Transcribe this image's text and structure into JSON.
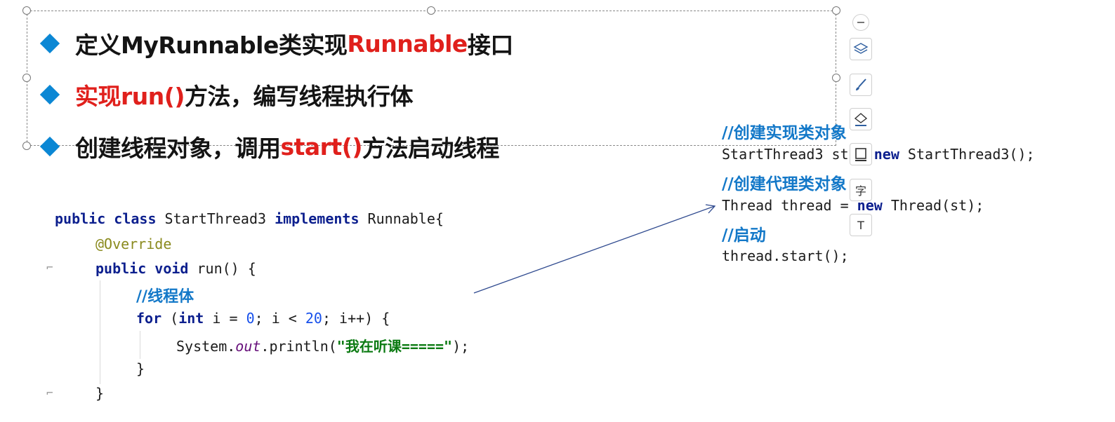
{
  "bullets": [
    {
      "parts": [
        {
          "text": "定义MyRunnable类实现",
          "color": "#141414"
        },
        {
          "text": "Runnable",
          "color": "#e0201c"
        },
        {
          "text": "接口",
          "color": "#141414"
        }
      ]
    },
    {
      "parts": [
        {
          "text": "实现run()",
          "color": "#e0201c"
        },
        {
          "text": "方法，编写线程执行体",
          "color": "#141414"
        }
      ]
    },
    {
      "parts": [
        {
          "text": "创建线程对象，调用",
          "color": "#141414"
        },
        {
          "text": "start()",
          "color": "#e0201c"
        },
        {
          "text": "方法启动线程",
          "color": "#141414"
        }
      ]
    }
  ],
  "left_code": {
    "l1_kw1": "public class",
    "l1_name": " StartThread3 ",
    "l1_kw2": "implements",
    "l1_tail": " Runnable{",
    "l2_annotation": "@Override",
    "l3_kw": "public void",
    "l3_tail": " run() {",
    "l4_comment": "//线程体",
    "l5_kw1": "for",
    "l5_a": " (",
    "l5_kw2": "int",
    "l5_b": " i = ",
    "l5_n1": "0",
    "l5_c": "; i < ",
    "l5_n2": "20",
    "l5_d": "; i++) {",
    "l6_a": "System.",
    "l6_field": "out",
    "l6_b": ".println(",
    "l6_str": "\"我在听课=====\"",
    "l6_c": ");",
    "l7": "}",
    "l8": "}"
  },
  "right_code": {
    "c1": "//创建实现类对象",
    "r1_a": "StartThread3 st = ",
    "r1_kw": "new",
    "r1_b": " StartThread3();",
    "c2": "//创建代理类对象",
    "r2_a": "Thread thread = ",
    "r2_kw": "new",
    "r2_b": " Thread(st);",
    "c3": "//启动",
    "r3": "thread.start();"
  },
  "toolbar": {
    "minus": "minus-icon",
    "layers": "layers-icon",
    "brush": "brush-icon",
    "fill": "fill-icon",
    "frame": "frame-icon",
    "text_wrap_label": "字",
    "text_box_label": "T"
  },
  "colors": {
    "bullet": "#0b87d4",
    "highlight": "#e0201c",
    "keyword": "#0c1f8e",
    "comment": "#1378c8",
    "string": "#0b7a12"
  }
}
